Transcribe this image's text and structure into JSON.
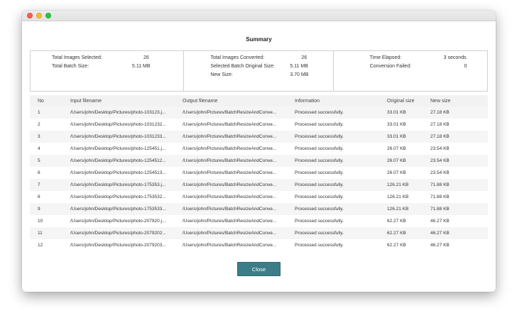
{
  "summary": {
    "title": "Summary"
  },
  "stats": {
    "total_images_selected_label": "Total Images Selected:",
    "total_images_selected_value": "26",
    "total_batch_size_label": "Total Batch Size:",
    "total_batch_size_value": "5.11 MB",
    "total_images_converted_label": "Total Images Converted:",
    "total_images_converted_value": "26",
    "selected_batch_original_size_label": "Selected Batch Original Size:",
    "selected_batch_original_size_value": "5.11 MB",
    "new_size_label": "New Size:",
    "new_size_value": "3.70 MB",
    "time_elapsed_label": "Time Elapsed:",
    "time_elapsed_value": "3 seconds",
    "conversion_failed_label": "Conversion Failed:",
    "conversion_failed_value": "0"
  },
  "table": {
    "headers": {
      "no": "No",
      "input": "Input filename",
      "output": "Output filename",
      "info": "Information",
      "original": "Original size",
      "new": "New size"
    },
    "rows": [
      {
        "no": "1",
        "input": "/Users/john/Desktop/Pictures/photo-103123.j...",
        "output": "/Users/john/Pictures/BatchResizeAndConve...",
        "info": "Processed successfully.",
        "original": "33.01 KB",
        "new": "27.18 KB"
      },
      {
        "no": "2",
        "input": "/Users/john/Desktop/Pictures/photo-1031232...",
        "output": "/Users/john/Pictures/BatchResizeAndConve...",
        "info": "Processed successfully.",
        "original": "33.01 KB",
        "new": "27.18 KB"
      },
      {
        "no": "3",
        "input": "/Users/john/Desktop/Pictures/photo-1031233...",
        "output": "/Users/john/Pictures/BatchResizeAndConve...",
        "info": "Processed successfully.",
        "original": "33.01 KB",
        "new": "27.18 KB"
      },
      {
        "no": "4",
        "input": "/Users/john/Desktop/Pictures/photo-125451.j...",
        "output": "/Users/john/Pictures/BatchResizeAndConve...",
        "info": "Processed successfully.",
        "original": "26.07 KB",
        "new": "23.54 KB"
      },
      {
        "no": "5",
        "input": "/Users/john/Desktop/Pictures/photo-1254512...",
        "output": "/Users/john/Pictures/BatchResizeAndConve...",
        "info": "Processed successfully.",
        "original": "26.07 KB",
        "new": "23.54 KB"
      },
      {
        "no": "6",
        "input": "/Users/john/Desktop/Pictures/photo-1254513...",
        "output": "/Users/john/Pictures/BatchResizeAndConve...",
        "info": "Processed successfully.",
        "original": "26.07 KB",
        "new": "23.54 KB"
      },
      {
        "no": "7",
        "input": "/Users/john/Desktop/Pictures/photo-175353.j...",
        "output": "/Users/john/Pictures/BatchResizeAndConve...",
        "info": "Processed successfully.",
        "original": "126.21 KB",
        "new": "71.88 KB"
      },
      {
        "no": "8",
        "input": "/Users/john/Desktop/Pictures/photo-1753532...",
        "output": "/Users/john/Pictures/BatchResizeAndConve...",
        "info": "Processed successfully.",
        "original": "126.21 KB",
        "new": "71.88 KB"
      },
      {
        "no": "9",
        "input": "/Users/john/Desktop/Pictures/photo-1753533...",
        "output": "/Users/john/Pictures/BatchResizeAndConve...",
        "info": "Processed successfully.",
        "original": "126.21 KB",
        "new": "71.88 KB"
      },
      {
        "no": "10",
        "input": "/Users/john/Desktop/Pictures/photo-207920.j...",
        "output": "/Users/john/Pictures/BatchResizeAndConve...",
        "info": "Processed successfully.",
        "original": "62.27 KB",
        "new": "46.27 KB"
      },
      {
        "no": "11",
        "input": "/Users/john/Desktop/Pictures/photo-2079202...",
        "output": "/Users/john/Pictures/BatchResizeAndConve...",
        "info": "Processed successfully.",
        "original": "62.27 KB",
        "new": "46.27 KB"
      },
      {
        "no": "12",
        "input": "/Users/john/Desktop/Pictures/photo-2079203...",
        "output": "/Users/john/Pictures/BatchResizeAndConve...",
        "info": "Processed successfully.",
        "original": "62.27 KB",
        "new": "46.27 KB"
      }
    ]
  },
  "footer": {
    "close_label": "Close"
  },
  "colors": {
    "accent": "#3c7e88",
    "traffic_close": "#fc5f57",
    "traffic_minimize": "#fdbc2e",
    "traffic_maximize": "#29c940"
  }
}
